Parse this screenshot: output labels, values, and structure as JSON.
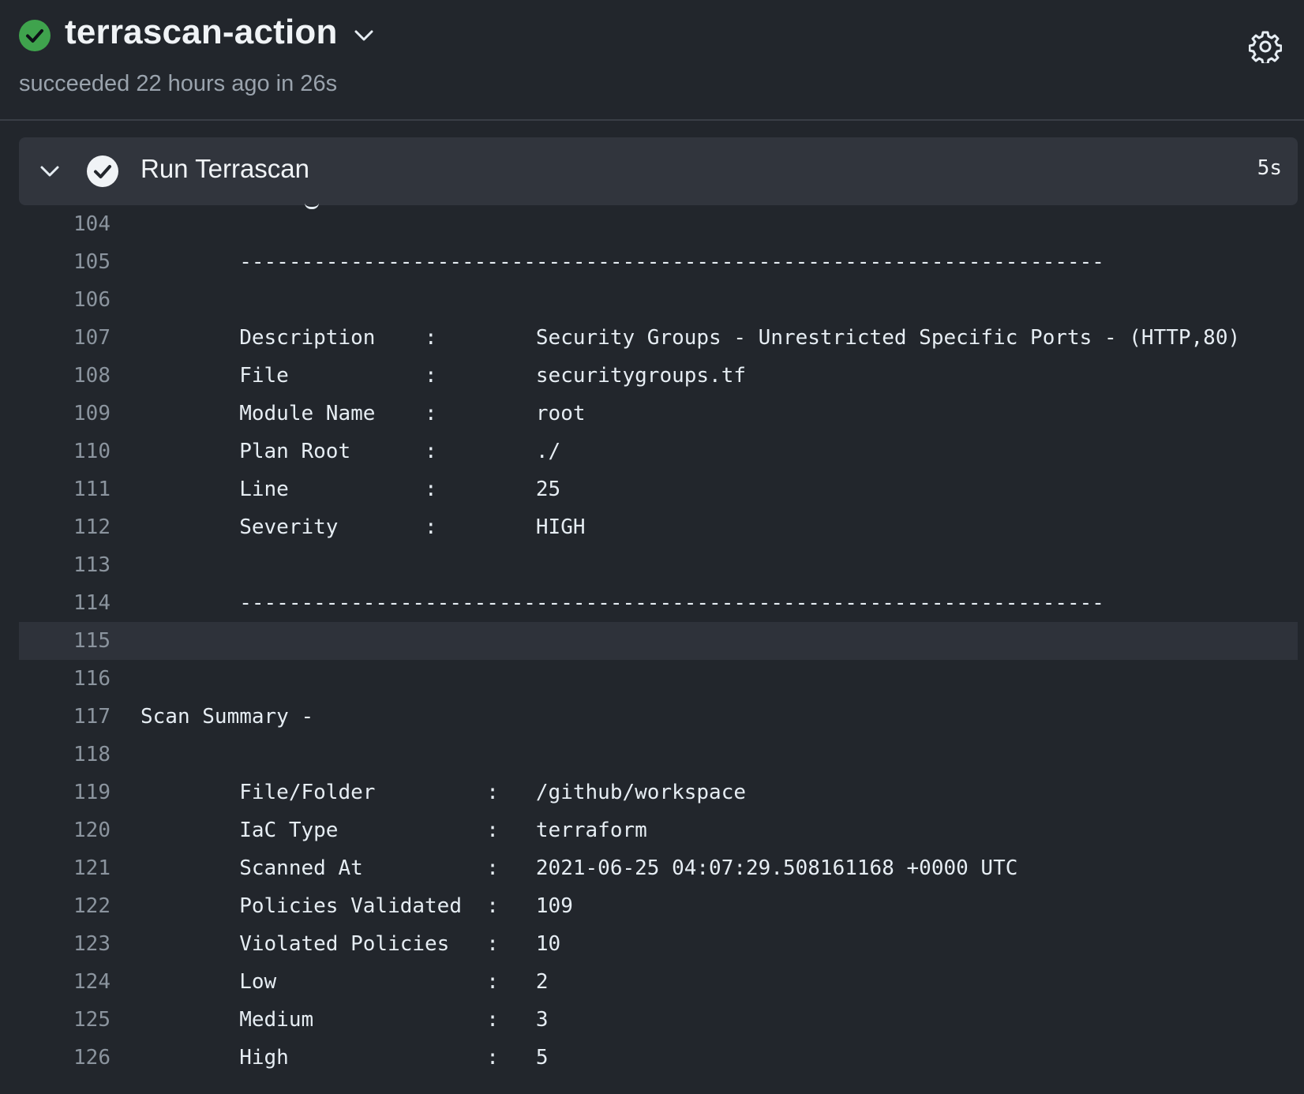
{
  "job": {
    "title": "terrascan-action",
    "subtitle": "succeeded 22 hours ago in 26s",
    "status_icon": "check-circle-icon",
    "status_color": "#3fa34d"
  },
  "step": {
    "title": "Run Terrascan",
    "duration": "5s"
  },
  "colors": {
    "background": "#22262c",
    "step_header": "#31353d",
    "highlight_row": "#2e323a",
    "line_number": "#8b949e"
  },
  "log_lines": [
    {
      "num": "104",
      "text": ""
    },
    {
      "num": "105",
      "text": "        ----------------------------------------------------------------------"
    },
    {
      "num": "106",
      "text": ""
    },
    {
      "num": "107",
      "text": "        Description    :        Security Groups - Unrestricted Specific Ports - (HTTP,80)"
    },
    {
      "num": "108",
      "text": "        File           :        securitygroups.tf"
    },
    {
      "num": "109",
      "text": "        Module Name    :        root"
    },
    {
      "num": "110",
      "text": "        Plan Root      :        ./"
    },
    {
      "num": "111",
      "text": "        Line           :        25"
    },
    {
      "num": "112",
      "text": "        Severity       :        HIGH"
    },
    {
      "num": "113",
      "text": ""
    },
    {
      "num": "114",
      "text": "        ----------------------------------------------------------------------"
    },
    {
      "num": "115",
      "text": "",
      "highlight": true
    },
    {
      "num": "116",
      "text": ""
    },
    {
      "num": "117",
      "text": "Scan Summary -"
    },
    {
      "num": "118",
      "text": ""
    },
    {
      "num": "119",
      "text": "        File/Folder         :   /github/workspace"
    },
    {
      "num": "120",
      "text": "        IaC Type            :   terraform"
    },
    {
      "num": "121",
      "text": "        Scanned At          :   2021-06-25 04:07:29.508161168 +0000 UTC"
    },
    {
      "num": "122",
      "text": "        Policies Validated  :   109"
    },
    {
      "num": "123",
      "text": "        Violated Policies   :   10"
    },
    {
      "num": "124",
      "text": "        Low                 :   2"
    },
    {
      "num": "125",
      "text": "        Medium              :   3"
    },
    {
      "num": "126",
      "text": "        High                :   5"
    }
  ]
}
